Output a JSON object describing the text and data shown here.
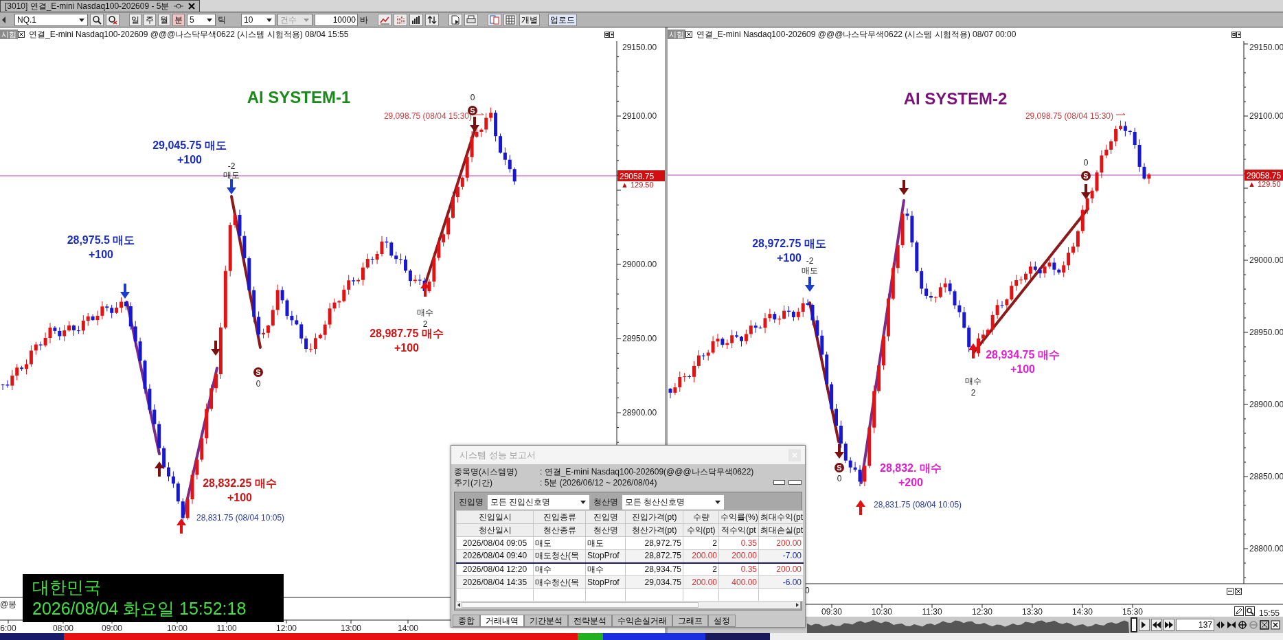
{
  "window": {
    "title": "[3010] 연결_E-mini Nasdaq100-202609 - 5분"
  },
  "toolbar": {
    "symbol": "NQ.1",
    "periods": [
      {
        "label": "일",
        "selected": false
      },
      {
        "label": "주",
        "selected": false
      },
      {
        "label": "월",
        "selected": false
      },
      {
        "label": "분",
        "selected": true
      }
    ],
    "interval": "5",
    "tick_label": "틱",
    "tick_value": "10",
    "count_select": {
      "label": "건수",
      "disabled": true
    },
    "count_value": "10000",
    "count_unit": "바",
    "buttons": [
      "개별",
      "업로드"
    ]
  },
  "charts": [
    {
      "badge": "시험",
      "title": "연결_E-mini Nasdaq100-202609 @@@나스닥무색0622 (시스템 시험적용) 08/04 15:55",
      "system": {
        "label": "AI SYSTEM-1",
        "color": "#1a8a1a"
      },
      "y_ticks": [
        "29150.00",
        "29100.00",
        "29000.00",
        "28950.00",
        "28900.00"
      ],
      "x_ticks": [
        "6:00",
        "08:00",
        "09:00",
        "10:00",
        "11:00",
        "12:00",
        "13:00",
        "14:00"
      ],
      "price_tag": "29058.75",
      "change": "▲ 129.50",
      "annotations": [
        {
          "kind": "extreme",
          "text": "29,098.75 (08/04 15:30)",
          "color": "#c83c3c"
        },
        {
          "kind": "trade",
          "lines": [
            "29,045.75 매도",
            "+100"
          ],
          "color": "#1a2cc0"
        },
        {
          "kind": "trade",
          "lines": [
            "28,975.5 매도",
            "+100"
          ],
          "color": "#1a2cc0"
        },
        {
          "kind": "trade",
          "lines": [
            "28,987.75 매수",
            "+100"
          ],
          "color": "#d01414"
        },
        {
          "kind": "trade",
          "lines": [
            "28,832.25 매수",
            "+100"
          ],
          "color": "#d01414"
        },
        {
          "kind": "extreme",
          "text": "28,831.75 (08/04 10:05)",
          "color": "#2a3a9a"
        }
      ],
      "signals": [
        {
          "kind": "sell"
        },
        {
          "kind": "sell",
          "labels": [
            "-2",
            "매도"
          ]
        },
        {
          "kind": "exit"
        },
        {
          "kind": "mark",
          "badge": "S",
          "labels": [
            "0"
          ]
        },
        {
          "kind": "buy"
        },
        {
          "kind": "exit_up"
        },
        {
          "kind": "buy",
          "labels": [
            "매수",
            "2"
          ]
        },
        {
          "kind": "exit",
          "badge": "S",
          "labels": [
            "0"
          ]
        }
      ],
      "footer_text": "@봉"
    },
    {
      "badge": "시험",
      "title": "연결_E-mini Nasdaq100-202609 @@@나스닥무색0622 (시스템 시험적용) 08/07 00:00",
      "system": {
        "label": "AI SYSTEM-2",
        "color": "#7a127a"
      },
      "y_ticks": [
        "29150.00",
        "29100.00",
        "29000.00",
        "28950.00",
        "28900.00",
        "28850.00",
        "28800.00"
      ],
      "x_ticks": [
        "09:30",
        "10:30",
        "11:30",
        "12:30",
        "13:30",
        "14:30",
        "15:30"
      ],
      "price_tag": "29058.75",
      "change": "▲ 129.50",
      "annotations": [
        {
          "kind": "extreme",
          "text": "29,098.75 (08/04 15:30)",
          "color": "#c83c3c"
        },
        {
          "kind": "trade",
          "lines": [
            "28,972.75 매도",
            "+100"
          ],
          "color": "#1a2cc0"
        },
        {
          "kind": "trade",
          "lines": [
            "28,934.75 매수",
            "+100"
          ],
          "color": "#e020d0"
        },
        {
          "kind": "trade",
          "lines": [
            "28,832. 매수",
            "+200"
          ],
          "color": "#e020d0"
        },
        {
          "kind": "extreme",
          "text": "28,831.75 (08/04 10:05)",
          "color": "#2a3a9a"
        }
      ],
      "signals": [
        {
          "kind": "sell",
          "labels": [
            "-2",
            "매도"
          ]
        },
        {
          "kind": "exit"
        },
        {
          "kind": "exit",
          "badge": "S",
          "labels": [
            "0"
          ]
        },
        {
          "kind": "buy"
        },
        {
          "kind": "buy",
          "labels": [
            "매수",
            "2"
          ]
        },
        {
          "kind": "exit",
          "badge": "S",
          "labels": [
            "0"
          ]
        }
      ],
      "footer_text": "0"
    }
  ],
  "report": {
    "title": "시스템 성능 보고서",
    "info": [
      {
        "label": "종목명(시스템명)",
        "value": ": 연결_E-mini Nasdaq100-202609(@@@나스닥무색0622)"
      },
      {
        "label": "주기(기간)",
        "value": ": 5분 (2026/06/12 ~ 2026/08/04)"
      }
    ],
    "entry_filter": {
      "label": "진입명",
      "value": "모든 진입신호명"
    },
    "exit_filter": {
      "label": "청산명",
      "value": "모든 청산신호명"
    },
    "header_rows": [
      [
        "진입일시",
        "진입종류",
        "진입명",
        "진입가격(pt)",
        "수량",
        "수익률(%)",
        "최대수익(pt"
      ],
      [
        "청산일시",
        "청산종류",
        "청산명",
        "청산가격(pt)",
        "수익(pt)",
        "적수익(pt",
        "최대손실(pt"
      ]
    ],
    "trades": [
      {
        "entry": [
          "2026/08/04 09:05",
          "매도",
          "매도",
          "28,972.75",
          "2",
          "0.35",
          "200.00"
        ],
        "exit": [
          "2026/08/04 09:40",
          "매도청산(목",
          "StopProf",
          "28,872.75",
          "200.00",
          "200.00",
          "-7.00"
        ]
      },
      {
        "entry": [
          "2026/08/04 12:20",
          "매수",
          "매수",
          "28,934.75",
          "2",
          "0.35",
          "200.00"
        ],
        "exit": [
          "2026/08/04 14:35",
          "매수청산(목",
          "StopProf",
          "29,034.75",
          "200.00",
          "400.00",
          "-6.00"
        ]
      }
    ],
    "tabs": [
      {
        "label": "종합",
        "selected": false
      },
      {
        "label": "거래내역",
        "selected": true
      },
      {
        "label": "기간분석",
        "selected": false
      },
      {
        "label": "전략분석",
        "selected": false
      },
      {
        "label": "수익손실거래",
        "selected": false
      },
      {
        "label": "그래프",
        "selected": false
      },
      {
        "label": "설정",
        "selected": false
      }
    ]
  },
  "clock": {
    "country": "대한민국",
    "datetime": "2026/08/04 화요일 15:52:18"
  },
  "navigator": {
    "end_time": "15:55",
    "bar_count": "137"
  }
}
